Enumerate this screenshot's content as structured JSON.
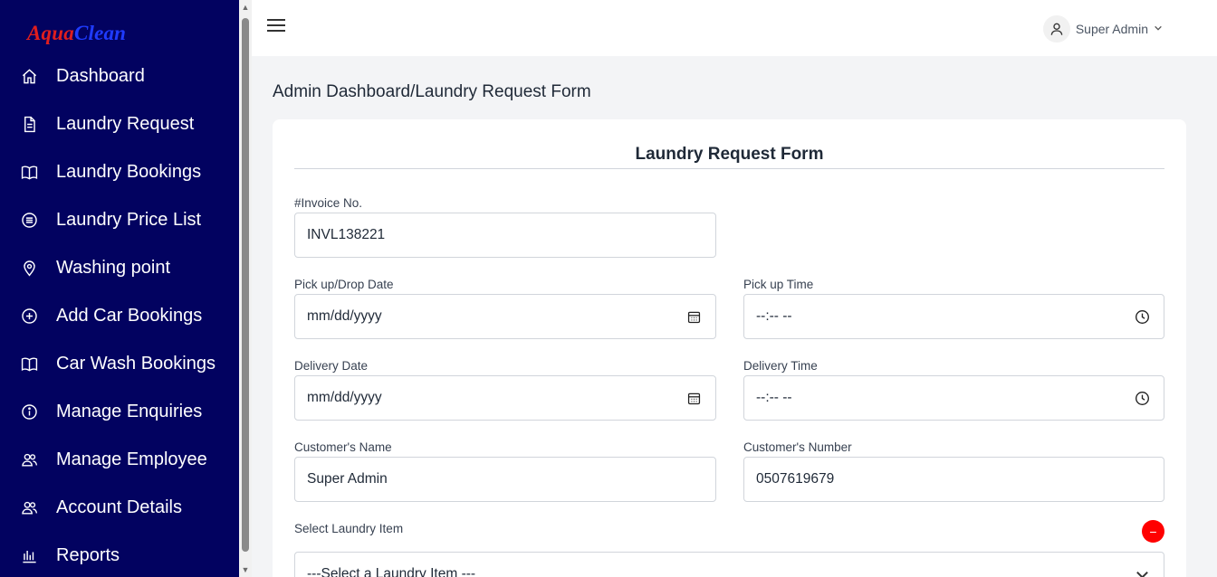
{
  "brand": {
    "part1": "Aqua",
    "part2": "Clean"
  },
  "sidebar": {
    "items": [
      {
        "label": "Dashboard",
        "icon": "home-icon"
      },
      {
        "label": "Laundry Request",
        "icon": "document-icon"
      },
      {
        "label": "Laundry Bookings",
        "icon": "book-icon"
      },
      {
        "label": "Laundry Price List",
        "icon": "list-circle-icon"
      },
      {
        "label": "Washing point",
        "icon": "map-pin-icon"
      },
      {
        "label": "Add Car Bookings",
        "icon": "plus-circle-icon"
      },
      {
        "label": "Car Wash Bookings",
        "icon": "book-icon"
      },
      {
        "label": "Manage Enquiries",
        "icon": "info-circle-icon"
      },
      {
        "label": "Manage Employee",
        "icon": "users-icon"
      },
      {
        "label": "Account Details",
        "icon": "users-icon"
      },
      {
        "label": "Reports",
        "icon": "bar-chart-icon"
      }
    ]
  },
  "header": {
    "user_name": "Super Admin"
  },
  "breadcrumb": "Admin Dashboard/Laundry Request Form",
  "form": {
    "title": "Laundry Request Form",
    "invoice_label": "#Invoice No.",
    "invoice_value": "INVL138221",
    "pickup_date_label": "Pick up/Drop Date",
    "pickup_date_value": "mm/dd/yyyy",
    "pickup_time_label": "Pick up Time",
    "pickup_time_value": "--:-- --",
    "delivery_date_label": "Delivery Date",
    "delivery_date_value": "mm/dd/yyyy",
    "delivery_time_label": "Delivery Time",
    "delivery_time_value": "--:-- --",
    "customer_name_label": "Customer's Name",
    "customer_name_value": "Super Admin",
    "customer_number_label": "Customer's Number",
    "customer_number_value": "0507619679",
    "laundry_item_label": "Select Laundry Item",
    "laundry_item_value": "---Select a Laundry Item ---",
    "remove_symbol": "−"
  },
  "colors": {
    "sidebar_bg": "#020260",
    "brand_red": "#e01e1e",
    "brand_blue": "#1f3bff",
    "remove_button": "#ff0000"
  }
}
